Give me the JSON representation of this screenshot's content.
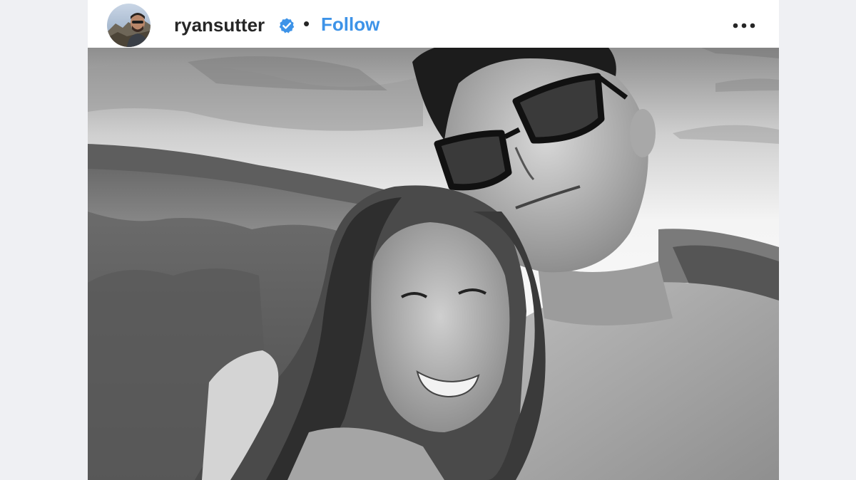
{
  "post": {
    "username": "ryansutter",
    "verified": true,
    "separator": "•",
    "follow_label": "Follow",
    "more_icon": "more-horizontal-icon",
    "photo": {
      "style": "black-and-white",
      "subject": "selfie of two people outdoors"
    }
  },
  "colors": {
    "page_background": "#eff0f3",
    "card_background": "#ffffff",
    "username": "#262626",
    "follow": "#3d93e8",
    "verified_badge": "#3d93e8"
  }
}
